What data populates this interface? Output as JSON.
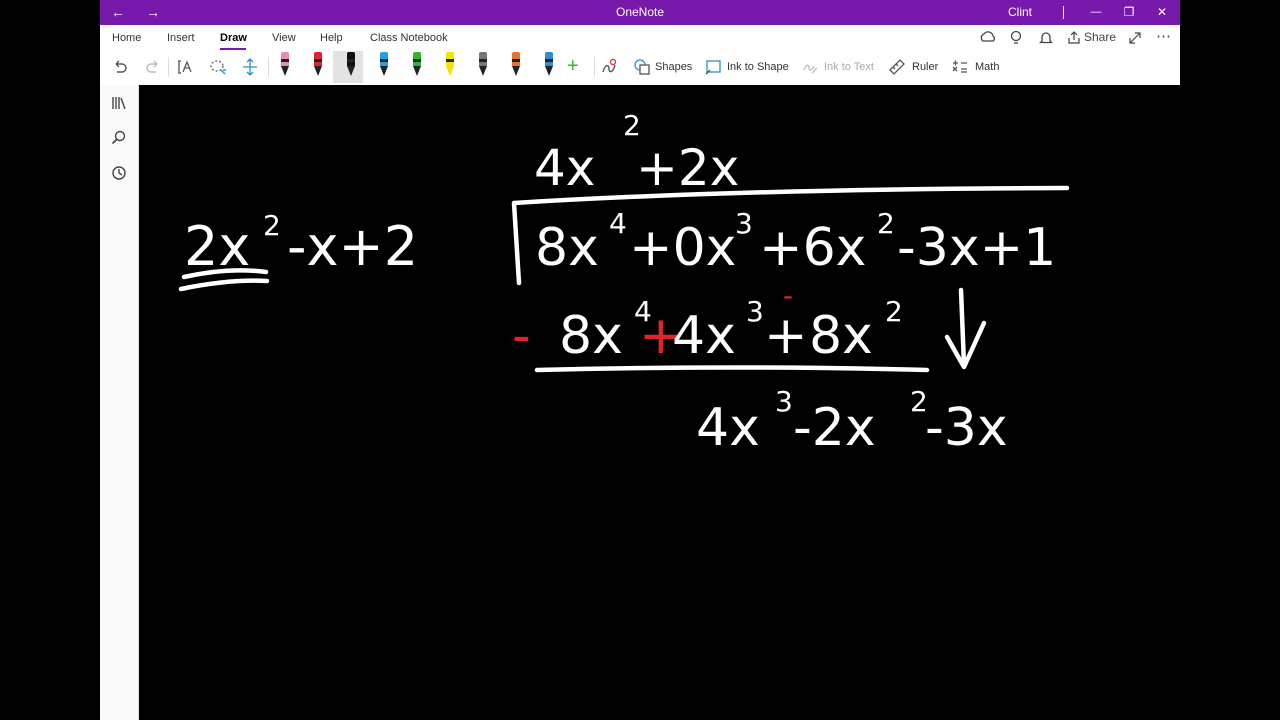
{
  "titlebar": {
    "title": "OneNote",
    "user": "Clint",
    "back": "←",
    "forward": "→",
    "minimize": "—",
    "restore": "❐",
    "close": "✕"
  },
  "ribbon": {
    "tabs": [
      "Home",
      "Insert",
      "Draw",
      "View",
      "Help",
      "Class Notebook"
    ],
    "active_tab": "Draw",
    "share_label": "Share",
    "more": "⋯",
    "tools": {
      "shapes": "Shapes",
      "ink_to_shape": "Ink to Shape",
      "ink_to_text": "Ink to Text",
      "ruler": "Ruler",
      "math": "Math"
    },
    "add_pen": "+"
  },
  "pens": [
    {
      "name": "pen-pink",
      "color": "#e78ab5"
    },
    {
      "name": "pen-red",
      "color": "#e0242c"
    },
    {
      "name": "pen-black",
      "color": "#111111"
    },
    {
      "name": "pen-blue",
      "color": "#1e9fe6"
    },
    {
      "name": "pen-green",
      "color": "#2eb82e"
    },
    {
      "name": "highlighter-yellow",
      "color": "#f5e400"
    },
    {
      "name": "pen-gray",
      "color": "#777777"
    },
    {
      "name": "pen-galaxy",
      "color": "#e8732a"
    },
    {
      "name": "pen-teal",
      "color": "#2a8fd0"
    }
  ],
  "colors": {
    "accent": "#7719aa",
    "ink": "#ffffff",
    "ink_red": "#e0242c",
    "canvas": "#000000"
  },
  "math": {
    "quotient": [
      "4x",
      "2",
      "+2x"
    ],
    "divisor": [
      "2x",
      "2",
      "-x+2"
    ],
    "dividend": [
      "8x",
      "4",
      "+0x",
      "3",
      "+6x",
      "2",
      "-3x+1"
    ],
    "subtract_row": [
      "-",
      "8x",
      "4",
      "+",
      "4x",
      "3",
      "+",
      "-",
      "8x",
      "2"
    ],
    "remainder": [
      "4x",
      "3",
      "-2x",
      "2",
      "-3x"
    ]
  }
}
